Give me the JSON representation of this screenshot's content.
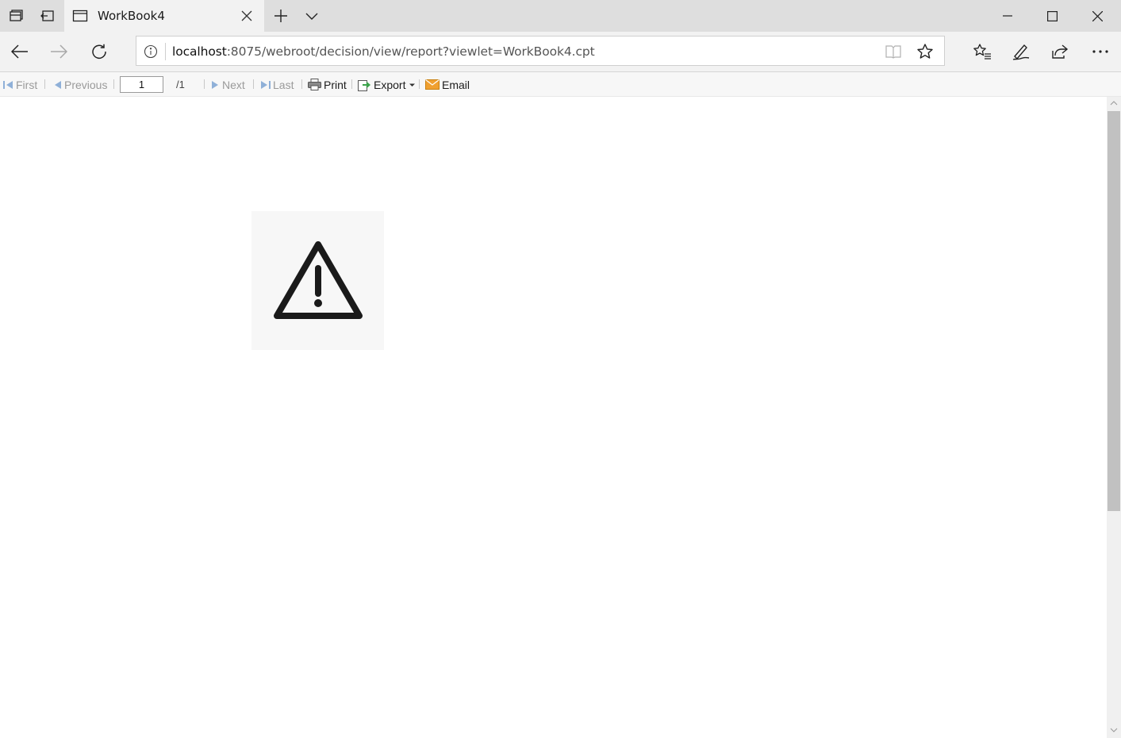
{
  "browser": {
    "tab_title": "WorkBook4",
    "url_host": "localhost",
    "url_rest": ":8075/webroot/decision/view/report?viewlet=WorkBook4.cpt"
  },
  "report_toolbar": {
    "first_label": "First",
    "previous_label": "Previous",
    "page_value": "1",
    "page_total": "/1",
    "next_label": "Next",
    "last_label": "Last",
    "print_label": "Print",
    "export_label": "Export",
    "email_label": "Email"
  },
  "icons": {
    "tab_actions": [
      "tabs-aside-icon",
      "restore-tabs-icon"
    ],
    "tab": [
      "page-icon",
      "close-icon"
    ],
    "tabbar": [
      "plus-icon",
      "chevron-down-icon"
    ],
    "window": [
      "minimize-icon",
      "maximize-icon",
      "close-icon"
    ],
    "nav": [
      "back-arrow-icon",
      "forward-arrow-icon",
      "refresh-icon"
    ],
    "address": [
      "info-icon",
      "reading-view-icon",
      "star-icon"
    ],
    "toolbar_right": [
      "favorites-icon",
      "pen-icon",
      "share-icon",
      "more-icon"
    ],
    "content": [
      "warning-icon"
    ]
  },
  "colors": {
    "tab_strip": "#dedede",
    "active_tab": "#f2f2f2",
    "disabled_text": "#9a9a9a",
    "export_green": "#3aa34a",
    "email_orange": "#f0a030",
    "nav_blue": "#8fb0d8"
  }
}
